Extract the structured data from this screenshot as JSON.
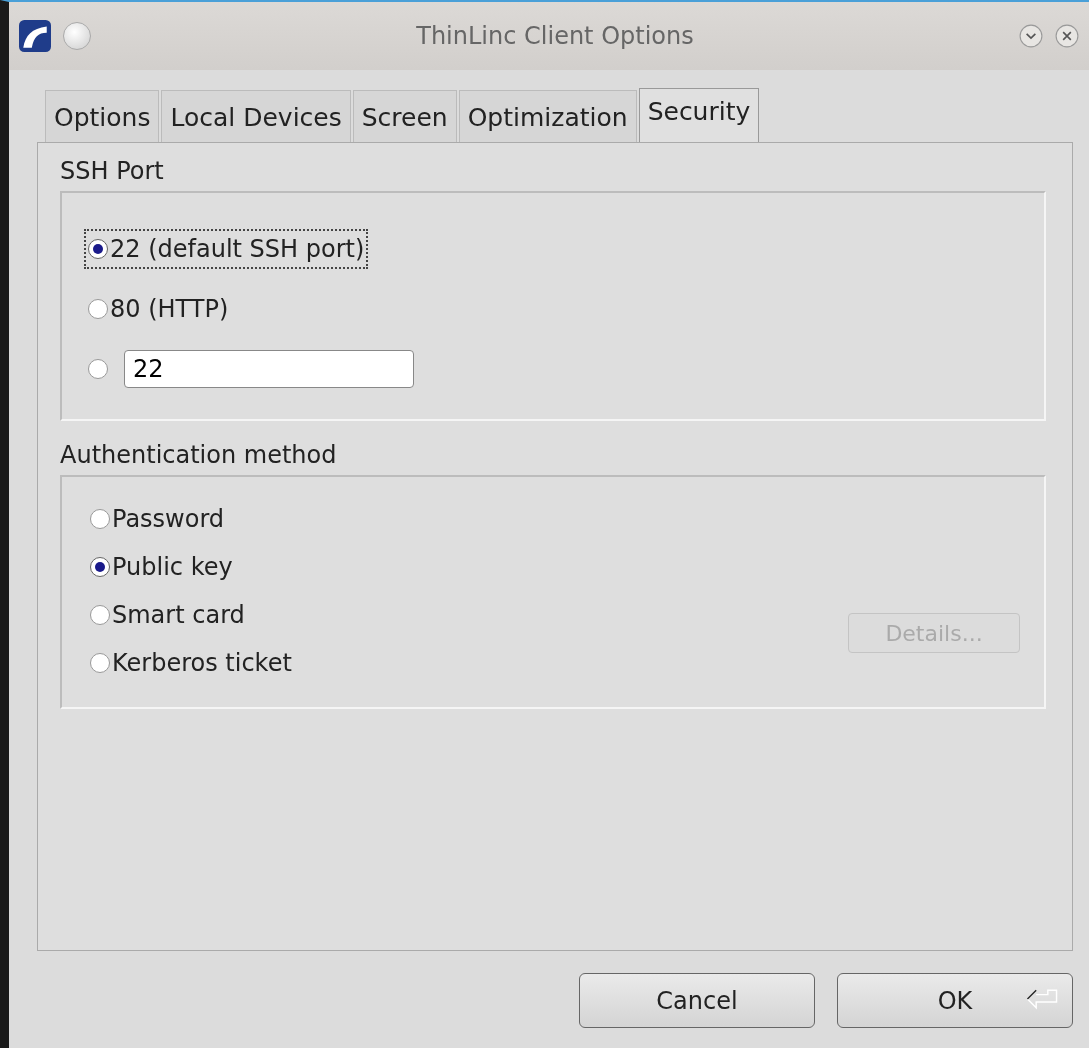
{
  "window": {
    "title": "ThinLinc Client Options"
  },
  "tabs": [
    {
      "label": "Options",
      "selected": false
    },
    {
      "label": "Local Devices",
      "selected": false
    },
    {
      "label": "Screen",
      "selected": false
    },
    {
      "label": "Optimization",
      "selected": false
    },
    {
      "label": "Security",
      "selected": true
    }
  ],
  "ssh_port": {
    "title": "SSH Port",
    "options": [
      {
        "kind": "radio",
        "label": "22 (default SSH port)",
        "selected": true,
        "focused": true
      },
      {
        "kind": "radio",
        "label": "80 (HTTP)",
        "selected": false,
        "focused": false
      },
      {
        "kind": "field",
        "value": "22",
        "selected": false,
        "focused": false
      }
    ]
  },
  "authentication": {
    "title": "Authentication method",
    "options": [
      {
        "label": "Password",
        "selected": false
      },
      {
        "label": "Public key",
        "selected": true
      },
      {
        "label": "Smart card",
        "selected": false
      },
      {
        "label": "Kerberos ticket",
        "selected": false
      }
    ],
    "details_button": {
      "label": "Details...",
      "disabled": true
    }
  },
  "buttons": [
    {
      "label": "Cancel",
      "kind": "plain"
    },
    {
      "label": "OK",
      "kind": "default"
    }
  ]
}
